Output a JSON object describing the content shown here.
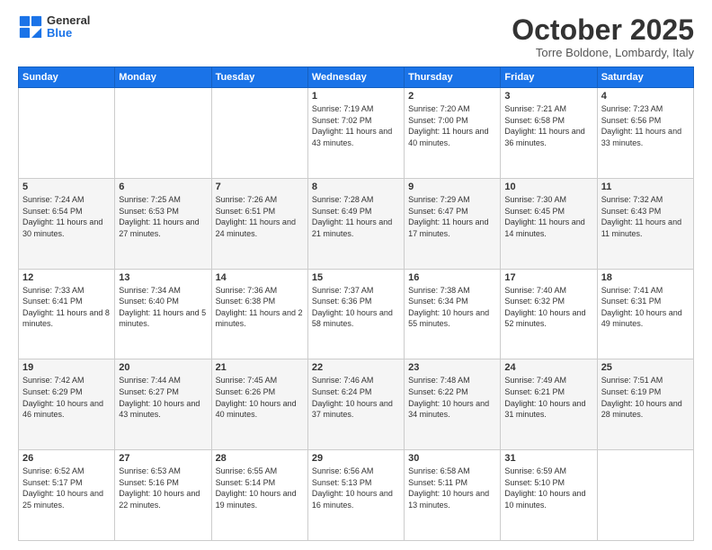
{
  "logo": {
    "general": "General",
    "blue": "Blue"
  },
  "header": {
    "month": "October 2025",
    "location": "Torre Boldone, Lombardy, Italy"
  },
  "days_of_week": [
    "Sunday",
    "Monday",
    "Tuesday",
    "Wednesday",
    "Thursday",
    "Friday",
    "Saturday"
  ],
  "weeks": [
    [
      {
        "day": "",
        "info": ""
      },
      {
        "day": "",
        "info": ""
      },
      {
        "day": "",
        "info": ""
      },
      {
        "day": "1",
        "info": "Sunrise: 7:19 AM\nSunset: 7:02 PM\nDaylight: 11 hours and 43 minutes."
      },
      {
        "day": "2",
        "info": "Sunrise: 7:20 AM\nSunset: 7:00 PM\nDaylight: 11 hours and 40 minutes."
      },
      {
        "day": "3",
        "info": "Sunrise: 7:21 AM\nSunset: 6:58 PM\nDaylight: 11 hours and 36 minutes."
      },
      {
        "day": "4",
        "info": "Sunrise: 7:23 AM\nSunset: 6:56 PM\nDaylight: 11 hours and 33 minutes."
      }
    ],
    [
      {
        "day": "5",
        "info": "Sunrise: 7:24 AM\nSunset: 6:54 PM\nDaylight: 11 hours and 30 minutes."
      },
      {
        "day": "6",
        "info": "Sunrise: 7:25 AM\nSunset: 6:53 PM\nDaylight: 11 hours and 27 minutes."
      },
      {
        "day": "7",
        "info": "Sunrise: 7:26 AM\nSunset: 6:51 PM\nDaylight: 11 hours and 24 minutes."
      },
      {
        "day": "8",
        "info": "Sunrise: 7:28 AM\nSunset: 6:49 PM\nDaylight: 11 hours and 21 minutes."
      },
      {
        "day": "9",
        "info": "Sunrise: 7:29 AM\nSunset: 6:47 PM\nDaylight: 11 hours and 17 minutes."
      },
      {
        "day": "10",
        "info": "Sunrise: 7:30 AM\nSunset: 6:45 PM\nDaylight: 11 hours and 14 minutes."
      },
      {
        "day": "11",
        "info": "Sunrise: 7:32 AM\nSunset: 6:43 PM\nDaylight: 11 hours and 11 minutes."
      }
    ],
    [
      {
        "day": "12",
        "info": "Sunrise: 7:33 AM\nSunset: 6:41 PM\nDaylight: 11 hours and 8 minutes."
      },
      {
        "day": "13",
        "info": "Sunrise: 7:34 AM\nSunset: 6:40 PM\nDaylight: 11 hours and 5 minutes."
      },
      {
        "day": "14",
        "info": "Sunrise: 7:36 AM\nSunset: 6:38 PM\nDaylight: 11 hours and 2 minutes."
      },
      {
        "day": "15",
        "info": "Sunrise: 7:37 AM\nSunset: 6:36 PM\nDaylight: 10 hours and 58 minutes."
      },
      {
        "day": "16",
        "info": "Sunrise: 7:38 AM\nSunset: 6:34 PM\nDaylight: 10 hours and 55 minutes."
      },
      {
        "day": "17",
        "info": "Sunrise: 7:40 AM\nSunset: 6:32 PM\nDaylight: 10 hours and 52 minutes."
      },
      {
        "day": "18",
        "info": "Sunrise: 7:41 AM\nSunset: 6:31 PM\nDaylight: 10 hours and 49 minutes."
      }
    ],
    [
      {
        "day": "19",
        "info": "Sunrise: 7:42 AM\nSunset: 6:29 PM\nDaylight: 10 hours and 46 minutes."
      },
      {
        "day": "20",
        "info": "Sunrise: 7:44 AM\nSunset: 6:27 PM\nDaylight: 10 hours and 43 minutes."
      },
      {
        "day": "21",
        "info": "Sunrise: 7:45 AM\nSunset: 6:26 PM\nDaylight: 10 hours and 40 minutes."
      },
      {
        "day": "22",
        "info": "Sunrise: 7:46 AM\nSunset: 6:24 PM\nDaylight: 10 hours and 37 minutes."
      },
      {
        "day": "23",
        "info": "Sunrise: 7:48 AM\nSunset: 6:22 PM\nDaylight: 10 hours and 34 minutes."
      },
      {
        "day": "24",
        "info": "Sunrise: 7:49 AM\nSunset: 6:21 PM\nDaylight: 10 hours and 31 minutes."
      },
      {
        "day": "25",
        "info": "Sunrise: 7:51 AM\nSunset: 6:19 PM\nDaylight: 10 hours and 28 minutes."
      }
    ],
    [
      {
        "day": "26",
        "info": "Sunrise: 6:52 AM\nSunset: 5:17 PM\nDaylight: 10 hours and 25 minutes."
      },
      {
        "day": "27",
        "info": "Sunrise: 6:53 AM\nSunset: 5:16 PM\nDaylight: 10 hours and 22 minutes."
      },
      {
        "day": "28",
        "info": "Sunrise: 6:55 AM\nSunset: 5:14 PM\nDaylight: 10 hours and 19 minutes."
      },
      {
        "day": "29",
        "info": "Sunrise: 6:56 AM\nSunset: 5:13 PM\nDaylight: 10 hours and 16 minutes."
      },
      {
        "day": "30",
        "info": "Sunrise: 6:58 AM\nSunset: 5:11 PM\nDaylight: 10 hours and 13 minutes."
      },
      {
        "day": "31",
        "info": "Sunrise: 6:59 AM\nSunset: 5:10 PM\nDaylight: 10 hours and 10 minutes."
      },
      {
        "day": "",
        "info": ""
      }
    ]
  ]
}
